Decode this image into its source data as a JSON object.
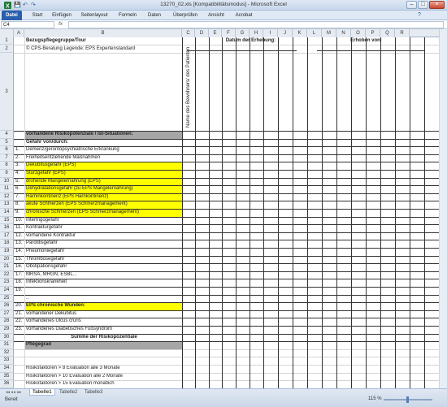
{
  "window": {
    "title": "13270_02.xls  [Kompatibilitätsmodus] - Microsoft Excel",
    "minimize": "–",
    "maximize": "□",
    "close": "×"
  },
  "qat": {
    "save": "💾",
    "undo": "↶",
    "redo": "↷"
  },
  "ribbon": {
    "tabs": [
      "Datei",
      "Start",
      "Einfügen",
      "Seitenlayout",
      "Formeln",
      "Daten",
      "Überprüfen",
      "Ansicht",
      "Acrobat"
    ]
  },
  "formula_bar": {
    "namebox": "C4",
    "fx": "fx",
    "value": ""
  },
  "columns": [
    "A",
    "B",
    "C",
    "D",
    "E",
    "F",
    "G",
    "H",
    "I",
    "J",
    "K",
    "L",
    "M",
    "N",
    "O",
    "P",
    "Q",
    "R"
  ],
  "rows": [
    {
      "n": "1",
      "a": "",
      "b": "Bezugspflegegruppe/Tour",
      "style": "bold"
    },
    {
      "n": "2",
      "a": "",
      "b": "© CPS-Beratung       Legende: EPS Expertenstandard",
      "style": ""
    },
    {
      "n": "3",
      "a": "",
      "b": "",
      "style": ""
    },
    {
      "n": "4",
      "a": "",
      "b": "vorhandene Risikopotenziale / Ist-Situationen:",
      "style": "gray bold"
    },
    {
      "n": "5",
      "a": "",
      "b": "Gefahr von/durch:",
      "style": "bold"
    },
    {
      "n": "6",
      "a": "1.",
      "b": "Demenz/gerontopsychiatrische Erkrankung",
      "style": ""
    },
    {
      "n": "7",
      "a": "2.",
      "b": "Freiheitsentziehende Maßnahmen",
      "style": ""
    },
    {
      "n": "8",
      "a": "3.",
      "b": "Dekubitusgefahr (EPS)",
      "style": "hl"
    },
    {
      "n": "9",
      "a": "4.",
      "b": "Sturzgefahr (EPS)",
      "style": "hl"
    },
    {
      "n": "10",
      "a": "5.",
      "b": "drohende Mangelernährung (EPS)",
      "style": "hl"
    },
    {
      "n": "11",
      "a": "6.",
      "b": "Dehydratationsgefahr (zu EPS Mangelernährung)",
      "style": "hl"
    },
    {
      "n": "12",
      "a": "7.",
      "b": "Harninkontinenz (EPS Harnkontinenz)",
      "style": "hl"
    },
    {
      "n": "13",
      "a": "8.",
      "b": "akute Schmerzen (EPS Schmerzmanagement)",
      "style": "hl"
    },
    {
      "n": "14",
      "a": "9.",
      "b": "chronische Schmerzen (EPS Schmerzmanagement)",
      "style": "hl"
    },
    {
      "n": "15",
      "a": "10.",
      "b": "Intertrigogefahr",
      "style": ""
    },
    {
      "n": "16",
      "a": "11.",
      "b": "Kontrakturgefahr",
      "style": ""
    },
    {
      "n": "17",
      "a": "12.",
      "b": "vorhandene Kontraktur",
      "style": ""
    },
    {
      "n": "18",
      "a": "13.",
      "b": "Parotitisgefahr",
      "style": ""
    },
    {
      "n": "19",
      "a": "14.",
      "b": "Pneumoniegefahr",
      "style": ""
    },
    {
      "n": "20",
      "a": "15.",
      "b": "Thrombosegefahr",
      "style": ""
    },
    {
      "n": "21",
      "a": "16.",
      "b": "Obstipationsgefahr",
      "style": ""
    },
    {
      "n": "22",
      "a": "17.",
      "b": "MRSA, MRGN, ESBL...",
      "style": ""
    },
    {
      "n": "23",
      "a": "18.",
      "b": "Infektionskrankheit",
      "style": ""
    },
    {
      "n": "24",
      "a": "19.",
      "b": "",
      "style": ""
    },
    {
      "n": "25",
      "a": "",
      "b": "..",
      "style": ""
    },
    {
      "n": "26",
      "a": "20.",
      "b": "EPS chronische Wunden:",
      "style": "hl bold"
    },
    {
      "n": "27",
      "a": "21.",
      "b": "vorhandener Dekubitus",
      "style": ""
    },
    {
      "n": "28",
      "a": "22.",
      "b": "vorhandenes Ulcus cruris",
      "style": ""
    },
    {
      "n": "29",
      "a": "23.",
      "b": "vorhandenes Diabetisches Fußsyndrom",
      "style": ""
    },
    {
      "n": "30",
      "a": "",
      "b": "Summe der Risikopozentiale",
      "style": "bold center"
    },
    {
      "n": "31",
      "a": "",
      "b": "Pflegegrad",
      "style": "gray bold"
    },
    {
      "n": "32",
      "a": "",
      "b": "",
      "style": ""
    },
    {
      "n": "33",
      "a": "",
      "b": "",
      "style": ""
    },
    {
      "n": "34",
      "a": "",
      "b": "Risikofaktoren > 8 Evaluation alle 3 Monate",
      "style": ""
    },
    {
      "n": "35",
      "a": "",
      "b": "Risikofaktoren > 10 Evaluation alle 2 Monate",
      "style": ""
    },
    {
      "n": "36",
      "a": "",
      "b": "Risikofaktoren > 15 Evaluation monatlich",
      "style": ""
    }
  ],
  "headers": {
    "datum": "Datum der Erhebung:",
    "erhoben": "Erhoben von:",
    "rotated": "Name des Bewohners/ des Patienten"
  },
  "status": {
    "sheets": [
      "Tabelle1",
      "Tabelle2",
      "Tabelle3"
    ],
    "ready": "Bereit",
    "zoom": "115 %"
  }
}
